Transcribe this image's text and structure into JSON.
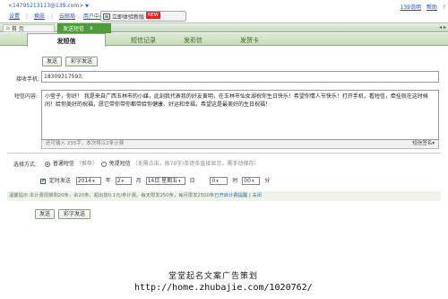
{
  "header": {
    "email": "<14795213113@139.com>",
    "email_arrow": "▼",
    "links": [
      "设置",
      "换肤",
      "云邮局",
      "用户中心"
    ],
    "weibo_button": "立即体验新版",
    "new_badge": "NEW",
    "right_links": [
      "139说明",
      "帮助"
    ]
  },
  "window_tabs": {
    "home": "首 页",
    "active": "发送短信",
    "close": "x",
    "nav": "◂ ▸"
  },
  "sub_tabs": [
    "发短信",
    "短信记录",
    "发彩信",
    "发贺卡"
  ],
  "toolbar_top": {
    "send": "发送",
    "color_send": "彩字发送"
  },
  "recipient": {
    "label": "接收手机:",
    "value": "18309317593;"
  },
  "content": {
    "label": "短信内容:",
    "text": "小莹子，你好！ 我是来自广西玉林市的小媒，此刻我代表我的好友黄明，在玉林市仙女湖祝你生日快乐！希望你情人节快乐！打开手机，看短信，牵挂就在这时候间！给你美好的祝福，愿它带你带你都带给你健康、好运和幸福，希望这是最美好的生日祝福！",
    "footer": "还可输入 235字，本次将以2条计费",
    "signature": "短信签名▾"
  },
  "send_mode": {
    "label": "选择方式:",
    "normal": "普通短信",
    "normal_hint": "（推荐）",
    "free": "免提短信",
    "free_hint": "（无需点击，按70字/条逐条直接显示，需手动保存）"
  },
  "timer": {
    "label": "定时发送",
    "year": "2014",
    "year_unit": "年",
    "month": "2",
    "month_unit": "月",
    "day": "14日 星期五",
    "day_unit": "日",
    "hour": "0",
    "hour_unit": "时",
    "minute": "00",
    "minute_unit": "分"
  },
  "hint": {
    "text": "温馨提示:本计费周期剩20条，余20条，超出按0.1元/条计费。每天限发250条，每月限发2500条",
    "link": "已开启计费提醒",
    "close": "| 关闭"
  },
  "toolbar_bottom": {
    "send": "发送",
    "color_send": "彩字发送"
  },
  "watermark": {
    "line1": "堂堂起名文案广告策划",
    "line2": "http://home.zhubajie.com/1020762/"
  }
}
